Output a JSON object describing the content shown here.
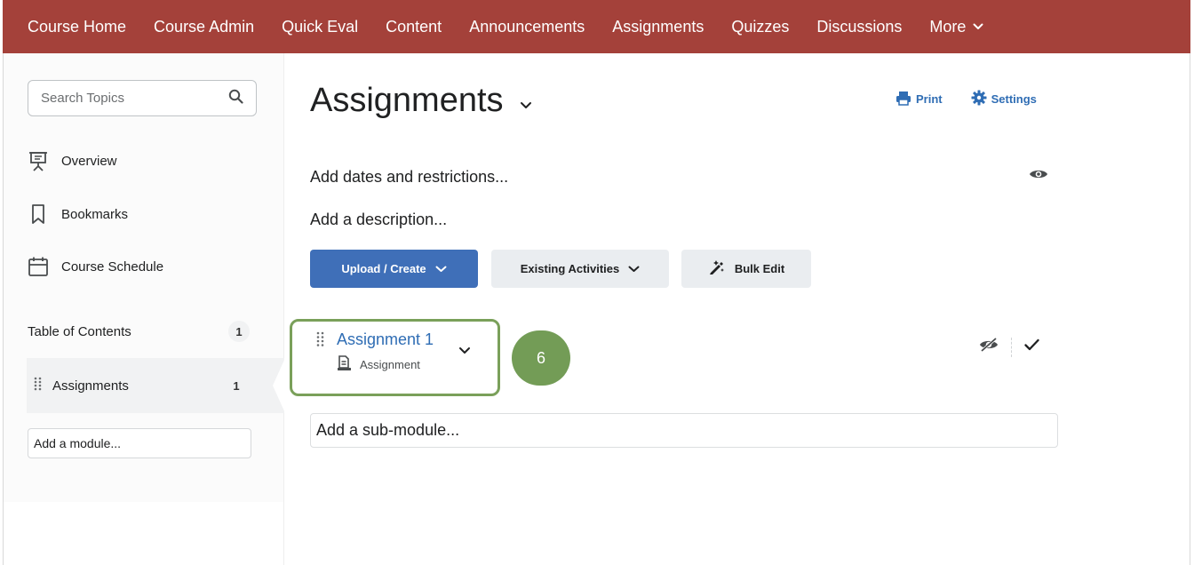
{
  "topnav": {
    "items": [
      "Course Home",
      "Course Admin",
      "Quick Eval",
      "Content",
      "Announcements",
      "Assignments",
      "Quizzes",
      "Discussions"
    ],
    "more_label": "More"
  },
  "sidebar": {
    "search_placeholder": "Search Topics",
    "links": [
      {
        "label": "Overview",
        "icon": "presentation-icon"
      },
      {
        "label": "Bookmarks",
        "icon": "bookmark-icon"
      },
      {
        "label": "Course Schedule",
        "icon": "calendar-icon"
      }
    ],
    "toc": {
      "label": "Table of Contents",
      "count": "1"
    },
    "module": {
      "label": "Assignments",
      "count": "1"
    },
    "add_module_placeholder": "Add a module..."
  },
  "main": {
    "title": "Assignments",
    "print_label": "Print",
    "settings_label": "Settings",
    "dates_link": "Add dates and restrictions...",
    "description_link": "Add a description...",
    "buttons": {
      "upload": "Upload / Create",
      "existing": "Existing Activities",
      "bulk": "Bulk Edit"
    },
    "assignment": {
      "title": "Assignment 1",
      "type": "Assignment"
    },
    "step_number": "6",
    "sub_module_placeholder": "Add a sub-module..."
  },
  "colors": {
    "nav_bg": "#a4413a",
    "link_blue": "#2f6db4",
    "primary_btn": "#3f6fb8",
    "highlight_green": "#7aa05a"
  }
}
